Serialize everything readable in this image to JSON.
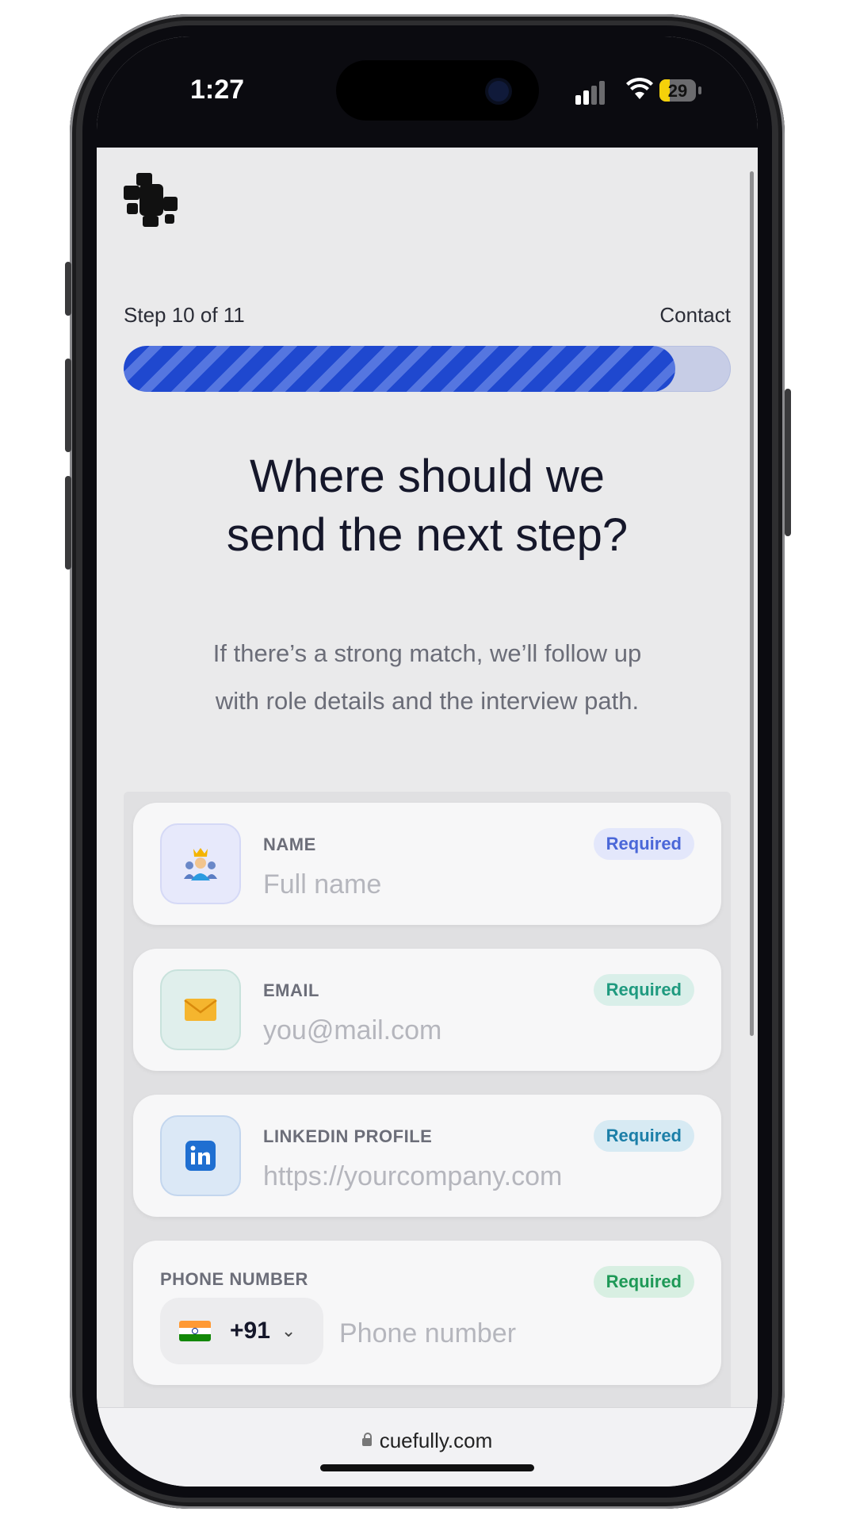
{
  "status_bar": {
    "time": "1:27",
    "battery": "29",
    "battery_level": 0.29
  },
  "progress": {
    "step_text": "Step 10 of 11",
    "section": "Contact",
    "fraction": 0.909
  },
  "heading": {
    "title_line1": "Where should we",
    "title_line2": "send the next step?",
    "subtitle_line1": "If there’s a strong match, we’ll follow up",
    "subtitle_line2": "with role details and the interview path."
  },
  "fields": [
    {
      "label": "NAME",
      "placeholder": "Full name",
      "badge": "Required",
      "icon": "people-crown-emoji"
    },
    {
      "label": "EMAIL",
      "placeholder": "you@mail.com",
      "badge": "Required",
      "icon": "envelope-emoji"
    },
    {
      "label": "LINKEDIN PROFILE",
      "placeholder": "https://yourcompany.com",
      "badge": "Required",
      "icon": "linkedin-icon"
    }
  ],
  "phone": {
    "label": "PHONE NUMBER",
    "badge": "Required",
    "country_code": "+91",
    "placeholder": "Phone number",
    "flag": "india-flag"
  },
  "browser": {
    "url": "cuefully.com"
  },
  "colors": {
    "accent": "#1f48cf",
    "background": "#eaeaeb"
  }
}
